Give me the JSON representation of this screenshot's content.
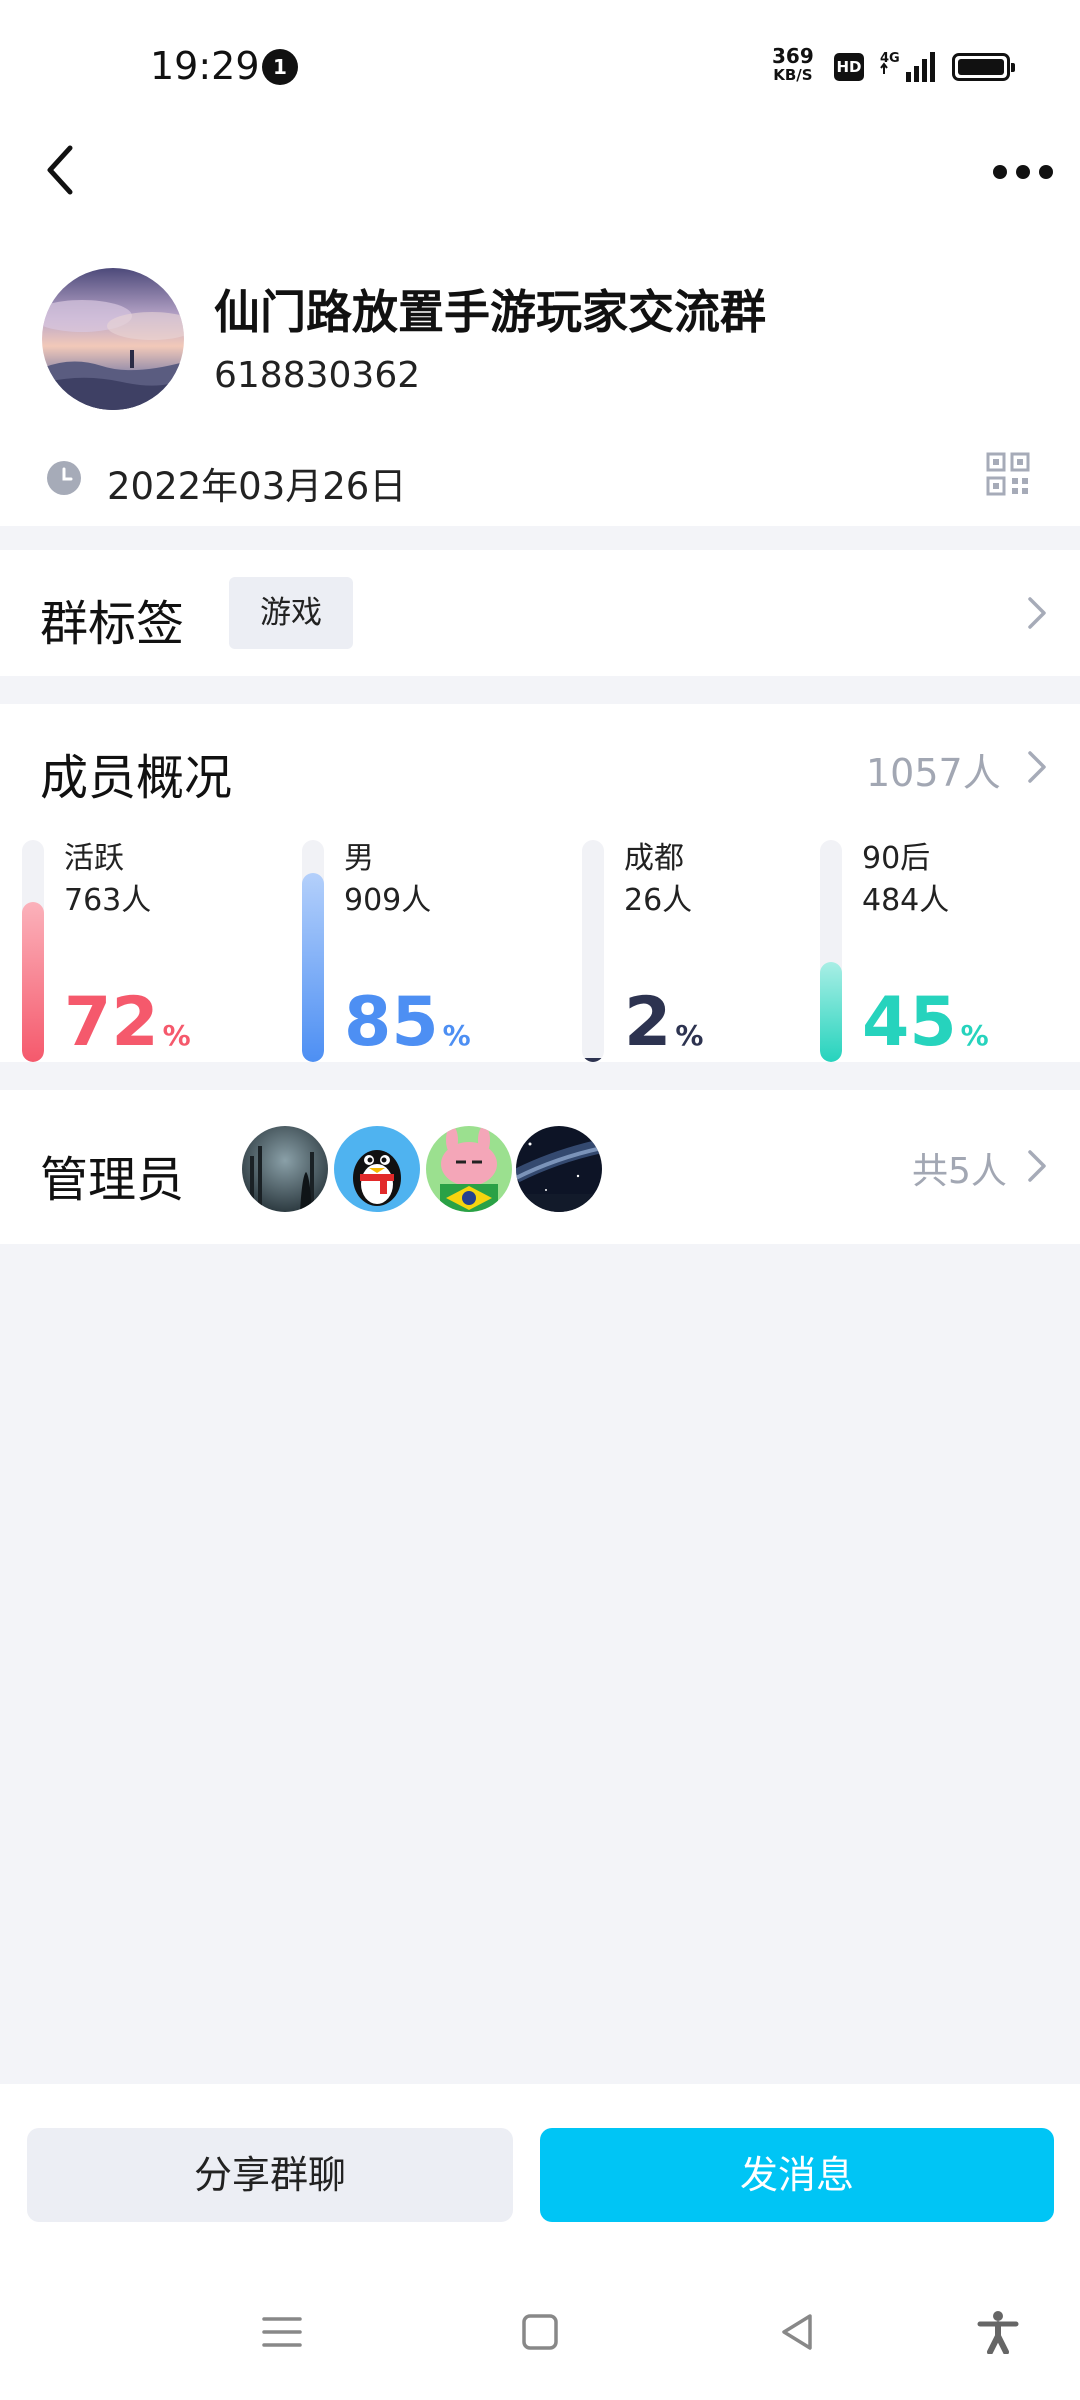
{
  "status_bar": {
    "time": "19:29",
    "notification_count": "1",
    "net_speed_value": "369",
    "net_speed_unit": "KB/S",
    "hd_label": "HD",
    "network_label": "4G"
  },
  "group": {
    "name": "仙门路放置手游玩家交流群",
    "id": "618830362",
    "created_date": "2022年03月26日"
  },
  "tags_section": {
    "title": "群标签",
    "tags": [
      "游戏"
    ]
  },
  "members_section": {
    "title": "成员概况",
    "total": "1057人",
    "stats": [
      {
        "label": "活跃",
        "count": "763人",
        "percent": "72",
        "percent_sign": "%",
        "fraction": 0.72,
        "color": "#f5596c",
        "color_light": "#fbb2bb"
      },
      {
        "label": "男",
        "count": "909人",
        "percent": "85",
        "percent_sign": "%",
        "fraction": 0.85,
        "color": "#4d8ff3",
        "color_light": "#b4d0fb"
      },
      {
        "label": "成都",
        "count": "26人",
        "percent": "2",
        "percent_sign": "%",
        "fraction": 0.02,
        "color": "#2d3350",
        "color_light": "#2d3350"
      },
      {
        "label": "90后",
        "count": "484人",
        "percent": "45",
        "percent_sign": "%",
        "fraction": 0.45,
        "color": "#26d3bd",
        "color_light": "#a8eee5"
      }
    ]
  },
  "admins_section": {
    "title": "管理员",
    "count_text": "共5人"
  },
  "actions": {
    "share_label": "分享群聊",
    "send_label": "发消息"
  }
}
